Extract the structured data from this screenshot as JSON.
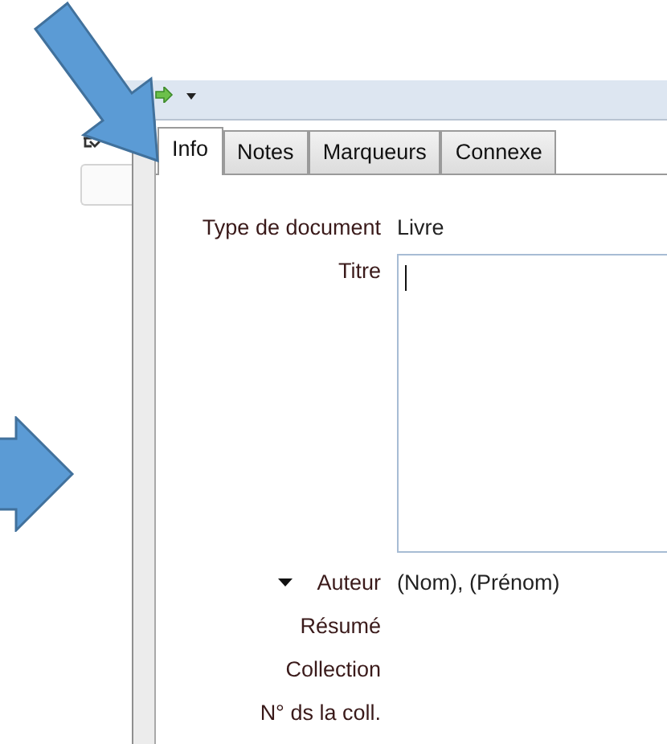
{
  "tabs": [
    {
      "label": "Info",
      "selected": true
    },
    {
      "label": "Notes",
      "selected": false
    },
    {
      "label": "Marqueurs",
      "selected": false
    },
    {
      "label": "Connexe",
      "selected": false
    }
  ],
  "fields": [
    {
      "kind": "text",
      "label": "Type de document",
      "value": "Livre"
    },
    {
      "kind": "textarea",
      "label": "Titre"
    },
    {
      "kind": "creator",
      "label": "Auteur",
      "value": "(Nom), (Prénom)",
      "expanded": true
    },
    {
      "kind": "text",
      "label": "Résumé"
    },
    {
      "kind": "text",
      "label": "Collection"
    },
    {
      "kind": "text",
      "label": "N° ds la coll."
    }
  ]
}
